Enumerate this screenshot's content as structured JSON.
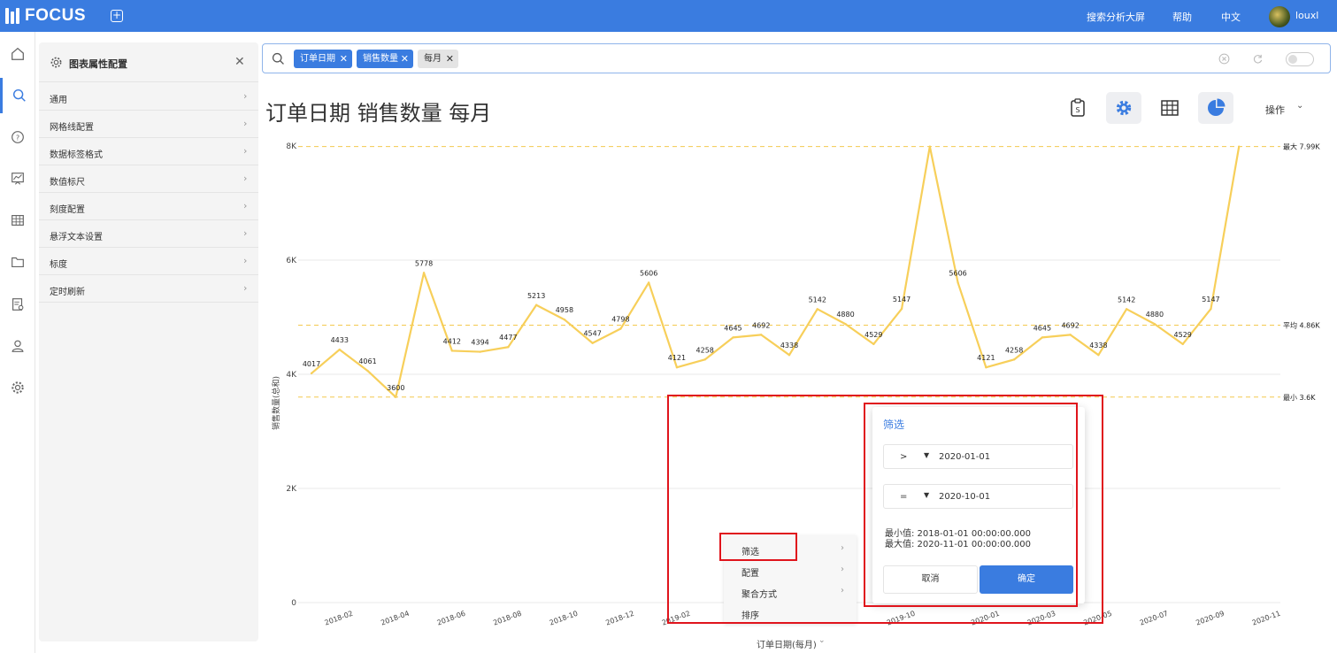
{
  "topbar": {
    "logo": "FOCUS",
    "nav": [
      "搜索分析大屏",
      "帮助",
      "中文"
    ],
    "username": "louxl"
  },
  "rail": {
    "icons": [
      "home-icon",
      "search-icon",
      "help-icon",
      "chart-board-icon",
      "table-icon",
      "folder-icon",
      "report-settings-icon",
      "user-icon",
      "settings-icon"
    ],
    "active": "search-icon"
  },
  "config_panel": {
    "title": "图表属性配置",
    "items": [
      "通用",
      "网格线配置",
      "数据标签格式",
      "数值标尺",
      "刻度配置",
      "悬浮文本设置",
      "标度",
      "定时刷新"
    ]
  },
  "search": {
    "chips": [
      {
        "label": "订单日期",
        "style": "blue"
      },
      {
        "label": "销售数量",
        "style": "blue"
      },
      {
        "label": "每月",
        "style": "gray"
      }
    ]
  },
  "header": {
    "chart_title": "订单日期 销售数量 每月",
    "tools": [
      "clipboard-icon",
      "gear-icon",
      "table-icon",
      "pie-chart-icon"
    ],
    "operation_label": "操作"
  },
  "chart_data": {
    "type": "line",
    "x": [
      "2018-01",
      "2018-02",
      "2018-03",
      "2018-04",
      "2018-05",
      "2018-06",
      "2018-07",
      "2018-08",
      "2018-09",
      "2018-10",
      "2018-11",
      "2018-12",
      "2019-01",
      "2019-02",
      "2019-03",
      "2019-04",
      "2019-05",
      "2019-06",
      "2019-07",
      "2019-08",
      "2019-09",
      "2019-10",
      "2019-11",
      "2019-12",
      "2020-01",
      "2020-02",
      "2020-03",
      "2020-04",
      "2020-05",
      "2020-06",
      "2020-07",
      "2020-08",
      "2020-09",
      "2020-10",
      "2020-11"
    ],
    "values": [
      4017,
      4433,
      4061,
      3600,
      5778,
      4412,
      4394,
      4477,
      5213,
      4958,
      4547,
      4798,
      5606,
      4121,
      4258,
      4645,
      4692,
      4338,
      5142,
      4880,
      4529,
      5147,
      7990,
      5606,
      4121,
      4258,
      4645,
      4692,
      4338,
      5142,
      4880,
      4529,
      5147,
      7990
    ],
    "visible_tick_labels": [
      "2018-02",
      "2018-04",
      "2018-06",
      "2018-08",
      "2018-10",
      "2018-12",
      "2019-02",
      "2019-10",
      "2020-01",
      "2020-03",
      "2020-05",
      "2020-07",
      "2020-09",
      "2020-11"
    ],
    "y_ticks": [
      "0",
      "2K",
      "4K",
      "6K",
      "8K"
    ],
    "ylim": [
      0,
      8000
    ],
    "ylabel": "销售数量(总和)",
    "xlabel": "订单日期(每月)",
    "reference_lines": [
      {
        "label": "最大 7.99K",
        "value": 7990
      },
      {
        "label": "平均 4.86K",
        "value": 4860
      },
      {
        "label": "最小 3.6K",
        "value": 3600
      }
    ],
    "line_color": "#f7cf5a",
    "grid": true
  },
  "context_menu": {
    "items": [
      {
        "label": "筛选",
        "has_submenu": true
      },
      {
        "label": "配置",
        "has_submenu": true
      },
      {
        "label": "聚合方式",
        "has_submenu": true
      },
      {
        "label": "排序",
        "has_submenu": false
      }
    ]
  },
  "filter_popup": {
    "title": "筛选",
    "conditions": [
      {
        "operator": ">",
        "value": "2020-01-01"
      },
      {
        "operator": "=",
        "value": "2020-10-01"
      }
    ],
    "min_text": "最小值: 2018-01-01 00:00:00.000",
    "max_text": "最大值: 2020-11-01 00:00:00.000",
    "cancel": "取消",
    "confirm": "确定"
  },
  "colors": {
    "brand": "#3a7ce0",
    "highlight": "#e0141c",
    "series": "#f7cf5a"
  }
}
